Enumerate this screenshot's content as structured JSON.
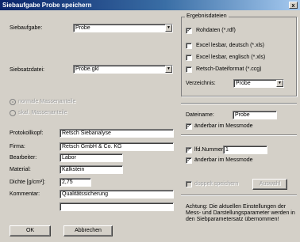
{
  "window": {
    "title": "Siebaufgabe Probe speichern",
    "close_glyph": "x"
  },
  "left": {
    "siebaufgabe_label": "Siebaufgabe:",
    "siebaufgabe_value": "Probe",
    "siebsatzdatei_label": "Siebsatzdatei:",
    "siebsatzdatei_value": "Probe.gkl",
    "radio1_label": "normale Massenanteile",
    "radio2_label": "skal. Massenanteile",
    "protokollkopf_label": "Protokollkopf:",
    "protokollkopf_value": "Retsch Siebanalyse",
    "firma_label": "Firma:",
    "firma_value": "Retsch GmbH & Co. KG",
    "bearbeiter_label": "Bearbeiter:",
    "bearbeiter_value": "Labor",
    "material_label": "Material:",
    "material_value": "Kalkstein",
    "dichte_label": "Dichte [g/cm³]:",
    "dichte_value": "2,75",
    "kommentar_label": "Kommentar:",
    "kommentar_value": "Qualitätssicherung",
    "kommentar2_value": ""
  },
  "buttons": {
    "ok": "OK",
    "cancel": "Abbrechen",
    "auswahl": "Auswahl"
  },
  "ergebnis": {
    "title": "Ergebnisdateien",
    "rohdaten": "Rohdaten (*.rdf)",
    "excel_de": "Excel lesbar, deutsch (*.xls)",
    "excel_en": "Excel lesbar, englisch (*.xls)",
    "retsch": "Retsch-Dateiformat (*.ccg)",
    "verzeichnis_label": "Verzeichnis:",
    "verzeichnis_value": "Probe",
    "check_mark": "✓"
  },
  "dateiname": {
    "label": "Dateiname:",
    "value": "Probe",
    "messmode": "änderbar im Messmode"
  },
  "lfdnummer": {
    "label": "lfd.Nummer:",
    "value": "1",
    "messmode": "änderbar im Messmode",
    "doppelt": "doppelt speichern"
  },
  "note": "Achtung: Die aktuellen Einstellungen der Mess- und Darstellungsparameter werden in den Siebparametersatz übernommen!"
}
